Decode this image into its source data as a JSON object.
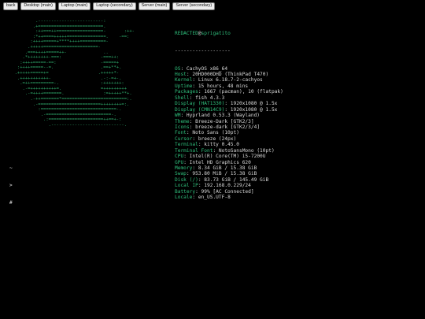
{
  "toolbar": {
    "buttons": [
      "back",
      "Desktop (main)",
      "Laptop (main)",
      "Laptop (secondary)",
      "Server (main)",
      "Server (secondary)"
    ]
  },
  "terminal": {
    "ascii_art": "          .-------------------------:\n         .+=========================.\n          :++===++==================-       :++-\n         :*++====+++++===============.    -==:\n        :++++=====+****++++==========-\n       .+++++=====================-\n      .===++++=====++-              ..\n     .*++++++++-===:               -===++:\n    :++++=====-==:                 -=====+\n   :++++=====--=.                  .==+**+.\n  .+++++=====+=                   .+++++*-\n   .+++++++++++-                   .-:-=+-.\n    .=++=========-.                :+++++++:\n     .-=++++++++++=.               =+++++++++\n      .-=++++=======.               :=+++++**+.\n        .-++=======*=========================:.\n         .-========================++++++++=:.\n           :=============================-.\n            .-=========================-.\n             .:=====================++==+-:\n               .----------------------------.",
    "user": "REDACTED",
    "at": "@",
    "host": "sprigatito",
    "separator": "-------------------",
    "info": [
      {
        "label": "OS",
        "value": "CachyOS x86_64"
      },
      {
        "label": "Host",
        "value": "20HD000DHD (ThinkPad T470)"
      },
      {
        "label": "Kernel",
        "value": "Linux 6.18.7-2-cachyos"
      },
      {
        "label": "Uptime",
        "value": "15 hours, 48 mins"
      },
      {
        "label": "Packages",
        "value": "1667 (pacman), 10 (flatpak)"
      },
      {
        "label": "Shell",
        "value": "fish 4.3.3"
      },
      {
        "label": "Display (HAT1330)",
        "value": "1920x1080 @ 1.5x"
      },
      {
        "label": "Display (CMN14C9)",
        "value": "1920x1080 @ 1.5x"
      },
      {
        "label": "WM",
        "value": "Hyprland 0.53.3 (Wayland)"
      },
      {
        "label": "Theme",
        "value": "Breeze-Dark [GTK2/3]"
      },
      {
        "label": "Icons",
        "value": "breeze-dark [GTK2/3/4]"
      },
      {
        "label": "Font",
        "value": "Noto Sans (10pt)"
      },
      {
        "label": "Cursor",
        "value": "breeze (24px)"
      },
      {
        "label": "Terminal",
        "value": "kitty 0.45.0"
      },
      {
        "label": "Terminal Font",
        "value": "NotoSansMono (10pt)"
      },
      {
        "label": "CPU",
        "value": "Intel(R) Core(TM) i5-7200U"
      },
      {
        "label": "GPU",
        "value": "Intel HD Graphics 620"
      },
      {
        "label": "Memory",
        "value": "8.34 GiB / 15.38 GiB"
      },
      {
        "label": "Swap",
        "value": "953.80 MiB / 15.38 GiB"
      },
      {
        "label": "Disk (/)",
        "value": "83.73 GiB / 145.49 GiB"
      },
      {
        "label": "Local IP",
        "value": "192.168.0.229/24"
      },
      {
        "label": "Battery",
        "value": "99% [AC Connected]"
      },
      {
        "label": "Locale",
        "value": "en_US.UTF-8"
      }
    ],
    "prompt_lines": [
      "~",
      ">",
      "#"
    ]
  },
  "colors": {
    "background": "#000000",
    "label": "#2fbf7c",
    "art": "#2ea86a",
    "text": "#d8d8d8"
  }
}
